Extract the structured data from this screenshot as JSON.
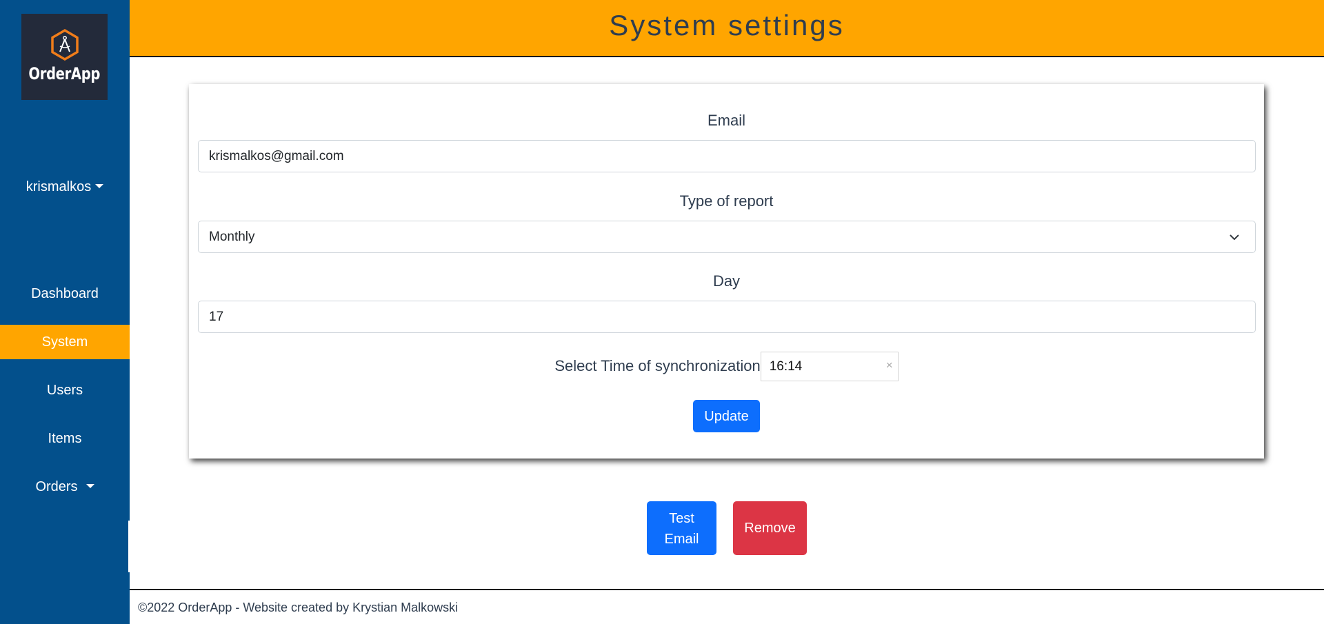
{
  "app": {
    "name": "OrderApp",
    "logo_icon": "compass-hexagon-icon"
  },
  "sidebar": {
    "user": {
      "label": "krismalkos",
      "icon": "caret-down-icon"
    },
    "items": [
      {
        "label": "Dashboard",
        "active": false
      },
      {
        "label": "System",
        "active": true
      },
      {
        "label": "Users",
        "active": false
      },
      {
        "label": "Items",
        "active": false
      },
      {
        "label": "Orders",
        "active": false,
        "has_dropdown": true
      }
    ]
  },
  "header": {
    "title": "System settings"
  },
  "form": {
    "email": {
      "label": "Email",
      "value": "krismalkos@gmail.com"
    },
    "report_type": {
      "label": "Type of report",
      "selected": "Monthly"
    },
    "day": {
      "label": "Day",
      "value": "17"
    },
    "sync_time": {
      "label": "Select Time of synchronization",
      "value": "16:14",
      "clear_icon": "×"
    },
    "update_label": "Update"
  },
  "actions": {
    "test_email_line1": "Test",
    "test_email_line2": "Email",
    "remove_label": "Remove"
  },
  "footer": {
    "text": "©2022 OrderApp - Website created by Krystian Malkowski"
  },
  "colors": {
    "sidebar": "#03508c",
    "accent": "#ffa500",
    "primary": "#0d6efd",
    "danger": "#dc3545",
    "logo_bg": "#232a3a"
  }
}
